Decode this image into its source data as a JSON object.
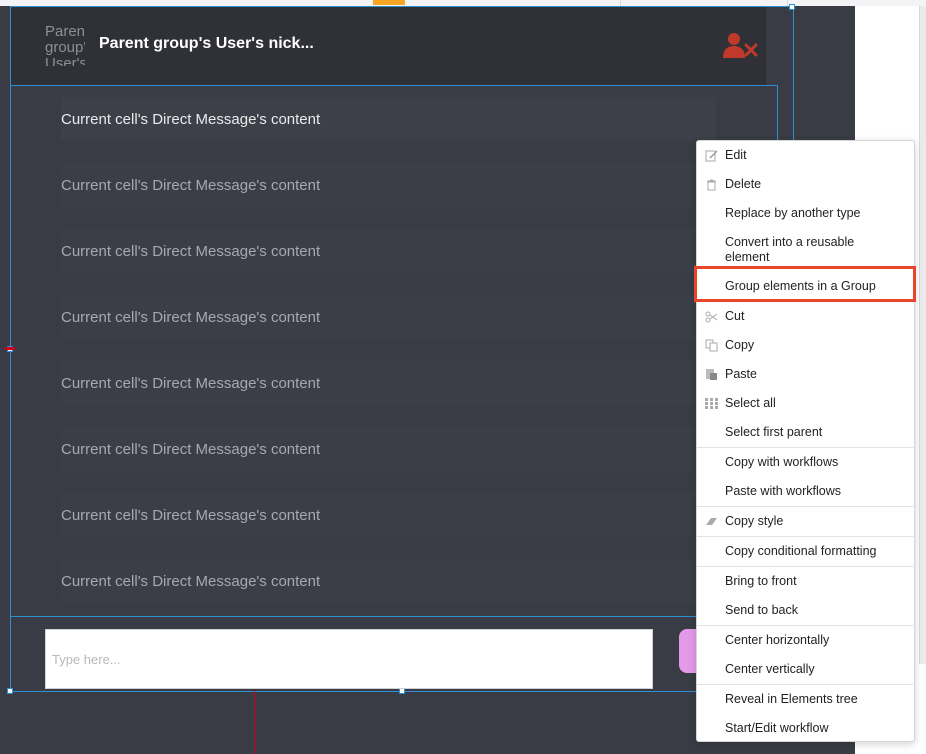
{
  "header": {
    "avatar_text": "Parent group's User's",
    "title": "Parent group's User's nick..."
  },
  "messages": [
    "Current cell's Direct Message's content",
    "Current cell's Direct Message's content",
    "Current cell's Direct Message's content",
    "Current cell's Direct Message's content",
    "Current cell's Direct Message's content",
    "Current cell's Direct Message's content",
    "Current cell's Direct Message's content",
    "Current cell's Direct Message's content"
  ],
  "input": {
    "placeholder": "Type here..."
  },
  "context_menu": {
    "edit": "Edit",
    "delete": "Delete",
    "replace": "Replace by another type",
    "convert_line1": "Convert into a reusable",
    "convert_line2": "element",
    "group": "Group elements in a Group",
    "cut": "Cut",
    "copy": "Copy",
    "paste": "Paste",
    "select_all": "Select all",
    "select_first_parent": "Select first parent",
    "copy_workflows": "Copy with workflows",
    "paste_workflows": "Paste with workflows",
    "copy_style": "Copy style",
    "copy_conditional": "Copy conditional formatting",
    "bring_front": "Bring to front",
    "send_back": "Send to back",
    "center_h": "Center horizontally",
    "center_v": "Center vertically",
    "reveal": "Reveal in Elements tree",
    "workflow": "Start/Edit workflow"
  },
  "colors": {
    "canvas": "#393c44",
    "header": "#2f3136",
    "selection": "#2f8fd3",
    "highlight": "#e8452c",
    "remove_user_icon": "#c0392b",
    "send_button": "#e39ae8"
  },
  "icons": {
    "header": "user-remove-icon",
    "edit": "pencil-icon",
    "delete": "trash-icon",
    "cut": "scissors-icon",
    "copy": "copy-icon",
    "paste": "paste-icon",
    "select_all": "grid-icon",
    "copy_style": "eraser-icon"
  }
}
